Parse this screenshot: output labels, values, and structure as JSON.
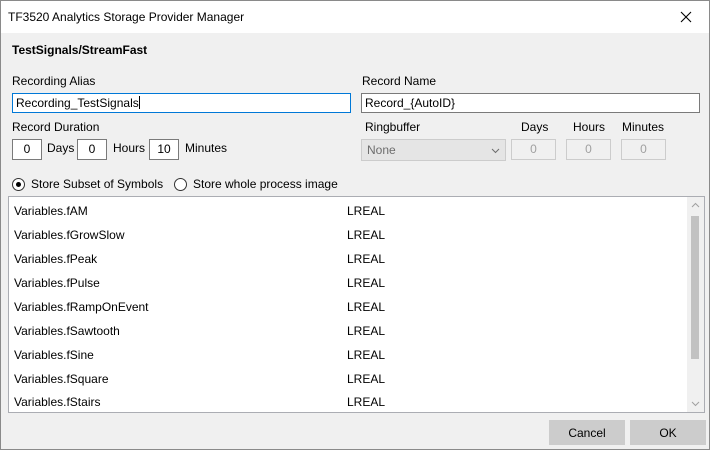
{
  "window": {
    "title": "TF3520 Analytics Storage Provider Manager",
    "path_title": "TestSignals/StreamFast"
  },
  "form": {
    "recording_alias_label": "Recording Alias",
    "recording_alias_value": "Recording_TestSignals",
    "record_name_label": "Record Name",
    "record_name_value": "Record_{AutoID}",
    "record_duration_label": "Record Duration",
    "duration_days_value": "0",
    "duration_days_label": "Days",
    "duration_hours_value": "0",
    "duration_hours_label": "Hours",
    "duration_minutes_value": "10",
    "duration_minutes_label": "Minutes",
    "ringbuffer_label": "Ringbuffer",
    "ringbuffer_value": "None",
    "rb_days_label": "Days",
    "rb_days_value": "0",
    "rb_hours_label": "Hours",
    "rb_hours_value": "0",
    "rb_minutes_label": "Minutes",
    "rb_minutes_value": "0"
  },
  "store_mode": {
    "subset_label": "Store Subset of Symbols",
    "subset_checked": true,
    "whole_label": "Store whole process image",
    "whole_checked": false
  },
  "symbols": [
    {
      "name": "Variables.fAM",
      "type": "LREAL"
    },
    {
      "name": "Variables.fGrowSlow",
      "type": "LREAL"
    },
    {
      "name": "Variables.fPeak",
      "type": "LREAL"
    },
    {
      "name": "Variables.fPulse",
      "type": "LREAL"
    },
    {
      "name": "Variables.fRampOnEvent",
      "type": "LREAL"
    },
    {
      "name": "Variables.fSawtooth",
      "type": "LREAL"
    },
    {
      "name": "Variables.fSine",
      "type": "LREAL"
    },
    {
      "name": "Variables.fSquare",
      "type": "LREAL"
    },
    {
      "name": "Variables.fStairs",
      "type": "LREAL"
    }
  ],
  "buttons": {
    "cancel_label": "Cancel",
    "ok_label": "OK"
  },
  "colors": {
    "focus_border": "#0078d7",
    "button_bg": "#cccccc",
    "window_bg": "#f0f0f0"
  },
  "icons": {
    "close": "close-icon",
    "combo_arrow": "chevron-down-icon",
    "scroll_up": "chevron-up-icon",
    "scroll_down": "chevron-down-icon"
  }
}
